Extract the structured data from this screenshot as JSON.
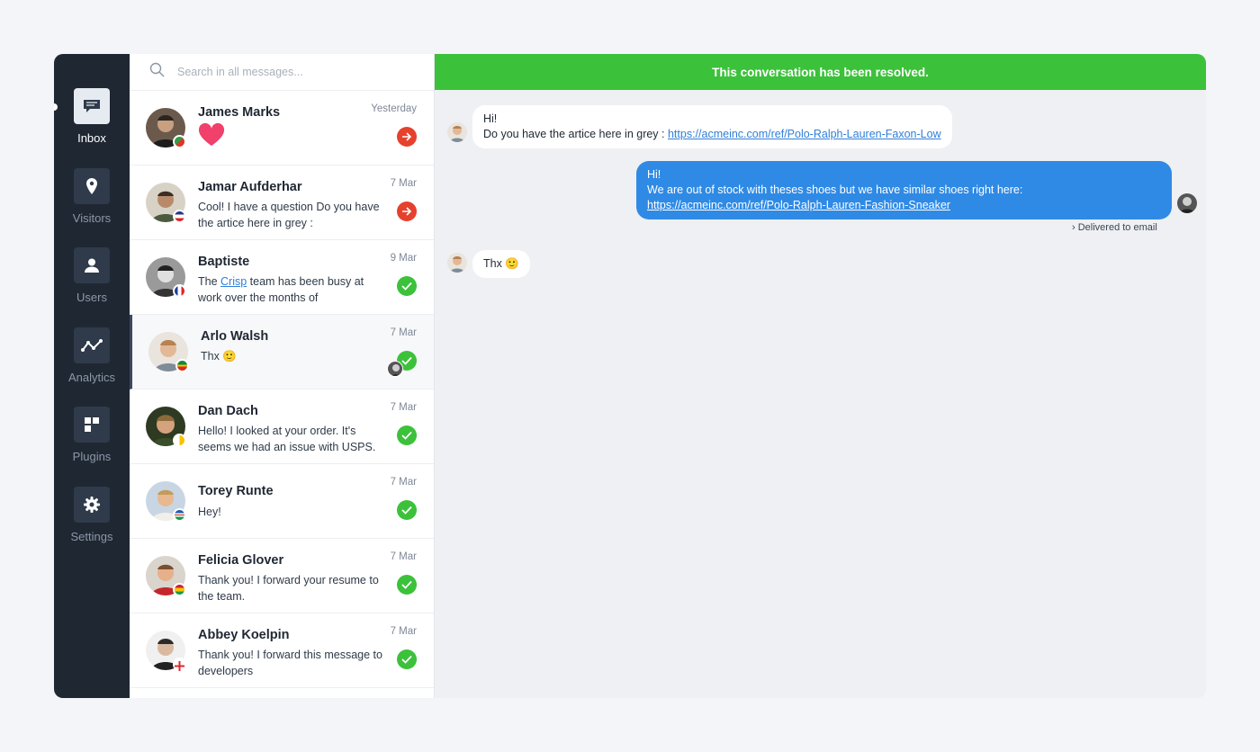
{
  "nav": {
    "items": [
      {
        "label": "Inbox",
        "icon": "chat-bubble-icon"
      },
      {
        "label": "Visitors",
        "icon": "map-pin-icon"
      },
      {
        "label": "Users",
        "icon": "user-icon"
      },
      {
        "label": "Analytics",
        "icon": "analytics-icon"
      },
      {
        "label": "Plugins",
        "icon": "plugins-icon"
      },
      {
        "label": "Settings",
        "icon": "gear-icon"
      }
    ]
  },
  "search": {
    "placeholder": "Search in all messages..."
  },
  "conversations": [
    {
      "name": "James Marks",
      "preview": "",
      "emoji": "❤",
      "date": "Yesterday",
      "status": "pending"
    },
    {
      "name": "Jamar Aufderhar",
      "preview": "Cool! I have a question Do you have the artice here in grey :",
      "date": "7 Mar",
      "status": "pending"
    },
    {
      "name": "Baptiste",
      "preview_before": "The ",
      "preview_link": "Crisp",
      "preview_after": " team has been busy at work over the months of",
      "date": "9 Mar",
      "status": "resolved"
    },
    {
      "name": "Arlo Walsh",
      "preview": "Thx 🙂",
      "date": "7 Mar",
      "status": "resolved"
    },
    {
      "name": "Dan Dach",
      "preview": "Hello! I looked at your order. It's seems we had an issue with USPS.",
      "date": "7 Mar",
      "status": "resolved"
    },
    {
      "name": "Torey Runte",
      "preview": "Hey!",
      "date": "7 Mar",
      "status": "resolved"
    },
    {
      "name": "Felicia Glover",
      "preview": "Thank you! I forward your resume to the team.",
      "date": "7 Mar",
      "status": "resolved"
    },
    {
      "name": "Abbey Koelpin",
      "preview": "Thank you! I forward this message to developers",
      "date": "7 Mar",
      "status": "resolved"
    }
  ],
  "chat": {
    "banner": "This conversation has been resolved.",
    "messages": [
      {
        "direction": "in",
        "line1": "Hi!",
        "line2": "Do you have the artice here in grey : ",
        "link": "https://acmeinc.com/ref/Polo-Ralph-Lauren-Faxon-Low"
      },
      {
        "direction": "out",
        "line1": "Hi!",
        "line2": "We are out of stock with theses shoes but we have similar shoes right here:",
        "link": "https://acmeinc.com/ref/Polo-Ralph-Lauren-Fashion-Sneaker",
        "receipt": "Delivered to email"
      },
      {
        "direction": "in",
        "text": "Thx 🙂"
      }
    ]
  },
  "colors": {
    "sidebar": "#1f2733",
    "resolved_green": "#3cc13b",
    "pending_red": "#e5412d",
    "outgoing_blue": "#2f8ae5",
    "link_blue": "#2f7fd9"
  }
}
